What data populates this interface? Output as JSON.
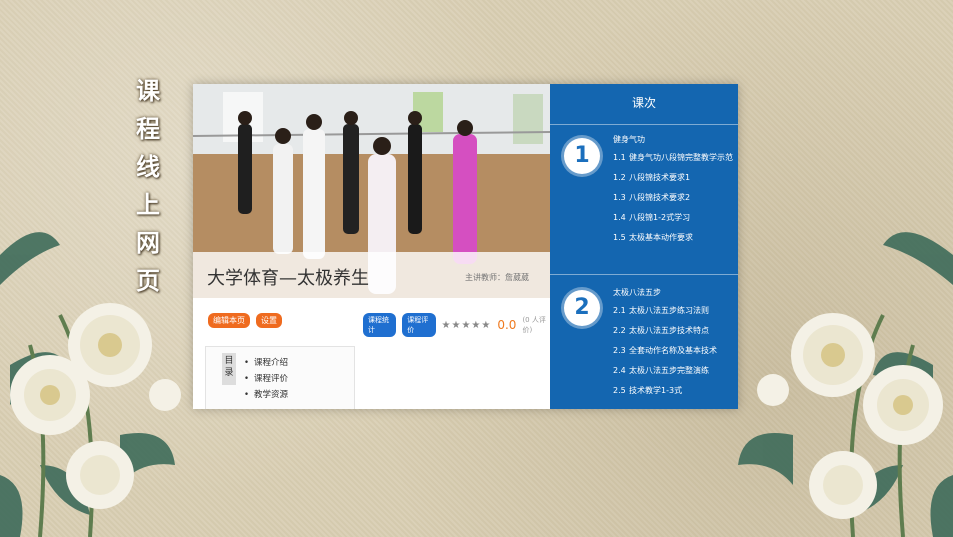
{
  "side_title": [
    "课",
    "程",
    "线",
    "上",
    "网",
    "页"
  ],
  "course": {
    "title": "大学体育—太极养生",
    "teacher": "主讲教师：詹葳葳",
    "tags": [
      "编辑本页",
      "设置"
    ],
    "stat_buttons": [
      "课程统计",
      "课程评价"
    ],
    "stars": "★★★★★",
    "score": "0.0",
    "ratings": "(0 人评价)",
    "menu_tag": "目录",
    "menu_items": [
      "课程介绍",
      "课程评价",
      "教学资源"
    ]
  },
  "lessons": {
    "title": "课次",
    "sections": [
      {
        "number": "1",
        "title": "健身气功",
        "items": [
          {
            "num": "1.1",
            "label": "健身气功八段锦完整教学示范"
          },
          {
            "num": "1.2",
            "label": "八段锦技术要求1"
          },
          {
            "num": "1.3",
            "label": "八段锦技术要求2"
          },
          {
            "num": "1.4",
            "label": "八段锦1-2式学习"
          },
          {
            "num": "1.5",
            "label": "太极基本动作要求"
          }
        ]
      },
      {
        "number": "2",
        "title": "太极八法五步",
        "items": [
          {
            "num": "2.1",
            "label": "太极八法五步练习法则"
          },
          {
            "num": "2.2",
            "label": "太极八法五步技术特点"
          },
          {
            "num": "2.3",
            "label": "全套动作名称及基本技术"
          },
          {
            "num": "2.4",
            "label": "太极八法五步完整演练"
          },
          {
            "num": "2.5",
            "label": "技术教学1-3式"
          }
        ]
      }
    ]
  },
  "colors": {
    "accent_blue": "#1466b0",
    "tag_orange": "#ef6b1f",
    "btn_blue": "#1f6fd0"
  }
}
